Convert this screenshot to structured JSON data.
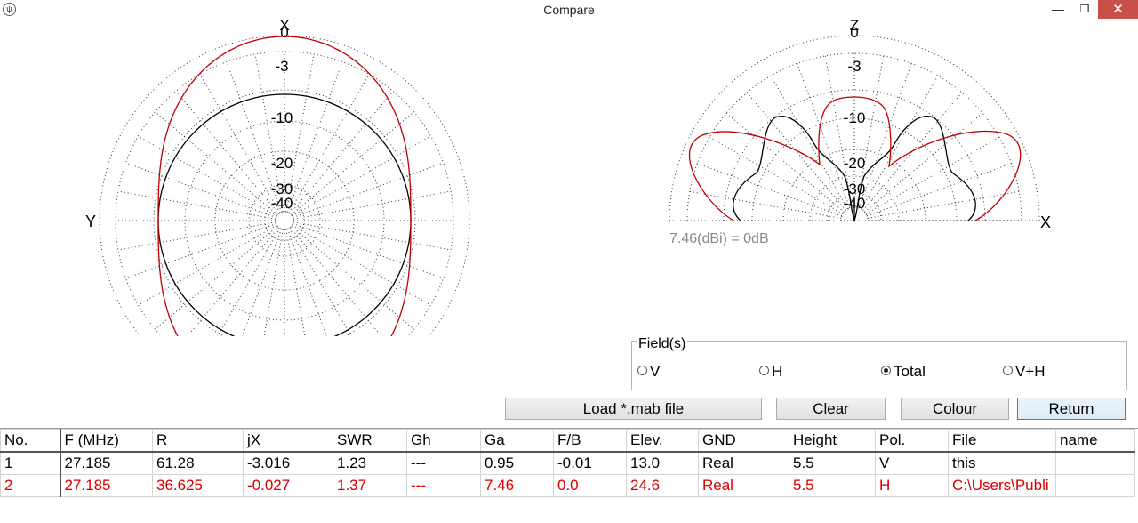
{
  "window": {
    "title": "Compare",
    "app_icon": "antenna-app-icon",
    "minimize": "—",
    "maximize": "❐",
    "close": "✕"
  },
  "azimuth_plot": {
    "axis_top": "X",
    "axis_left": "Y",
    "ring_labels": [
      "0",
      "-3",
      "-10",
      "-20",
      "-30",
      "-40"
    ],
    "series": [
      {
        "color": "#000000"
      },
      {
        "color": "#c00000"
      }
    ]
  },
  "elevation_plot": {
    "axis_top": "Z",
    "axis_right": "X",
    "ring_labels": [
      "0",
      "-3",
      "-10",
      "-20",
      "-30",
      "-40"
    ],
    "gain_note": "7.46(dBi) = 0dB"
  },
  "fields": {
    "legend": "Field(s)",
    "options": [
      {
        "label": "V",
        "selected": false
      },
      {
        "label": "H",
        "selected": false
      },
      {
        "label": "Total",
        "selected": true
      },
      {
        "label": "V+H",
        "selected": false
      }
    ]
  },
  "buttons": {
    "load": "Load *.mab file",
    "clear": "Clear",
    "colour": "Colour",
    "return": "Return"
  },
  "table": {
    "headers": [
      "No.",
      "F (MHz)",
      "R",
      "jX",
      "SWR",
      "Gh",
      "Ga",
      "F/B",
      "Elev.",
      "GND",
      "Height",
      "Pol.",
      "File",
      "name"
    ],
    "rows": [
      [
        "1",
        "27.185",
        "61.28",
        "-3.016",
        "1.23",
        "---",
        "0.95",
        "-0.01",
        "13.0",
        "Real",
        "5.5",
        "V",
        "this",
        ""
      ],
      [
        "2",
        "27.185",
        "36.625",
        "-0.027",
        "1.37",
        "---",
        "7.46",
        "0.0",
        "24.6",
        "Real",
        "5.5",
        "H",
        "C:\\Users\\Publi",
        ""
      ]
    ]
  }
}
